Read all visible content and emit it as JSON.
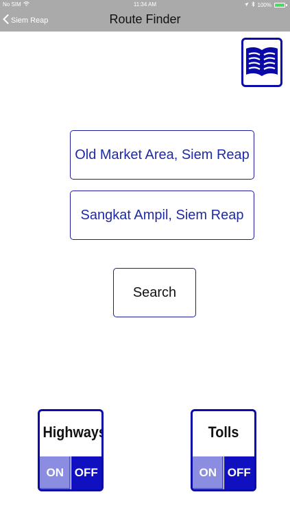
{
  "status_bar": {
    "carrier": "No SIM",
    "time": "11:34 AM",
    "battery": "100%"
  },
  "nav": {
    "back_label": "Siem Reap",
    "title": "Route Finder"
  },
  "icons": {
    "book": "book-icon",
    "back": "chevron-left-icon",
    "wifi": "wifi-icon",
    "location": "location-arrow-icon",
    "bluetooth": "bluetooth-icon",
    "battery": "battery-icon"
  },
  "route": {
    "origin": "Old Market Area, Siem Reap",
    "destination": "Sangkat Ampil, Siem Reap",
    "search_label": "Search"
  },
  "toggles": {
    "highways": {
      "label": "Highways",
      "on_label": "ON",
      "off_label": "OFF",
      "state": "OFF"
    },
    "tolls": {
      "label": "Tolls",
      "on_label": "ON",
      "off_label": "OFF",
      "state": "OFF"
    }
  },
  "colors": {
    "bar_background": "#aaaaaa",
    "accent_blue": "#0a0aa8",
    "field_text": "#1e2aa6",
    "toggle_on": "#8a8de0",
    "toggle_off": "#1010c0"
  }
}
